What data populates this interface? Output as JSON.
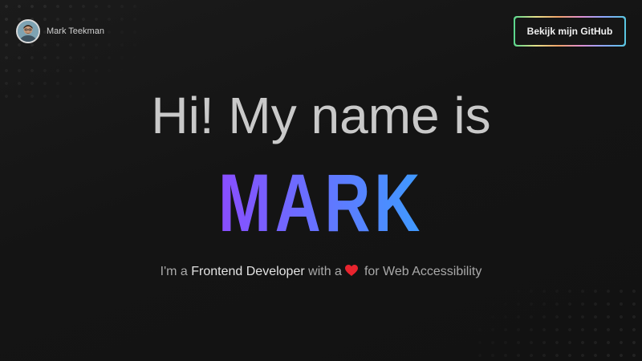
{
  "header": {
    "name": "Mark Teekman",
    "github_button": "Bekijk mijn GitHub"
  },
  "hero": {
    "greeting": "Hi! My name is",
    "name": "MARK",
    "tagline_prefix": "I'm a",
    "tagline_role": "Frontend Developer",
    "tagline_mid": "with a",
    "tagline_suffix": "for Web Accessibility"
  },
  "icons": {
    "avatar": "profile-photo",
    "heart": "heart-icon"
  },
  "colors": {
    "background": "#141414",
    "name_gradient_start": "#8a4dff",
    "name_gradient_end": "#3e9bff",
    "heart": "#e8242e",
    "button_border_gradient": [
      "#58d68d",
      "#e6e08a",
      "#f0a36a",
      "#e08fd0",
      "#8fa6ff",
      "#58c6e0"
    ]
  }
}
